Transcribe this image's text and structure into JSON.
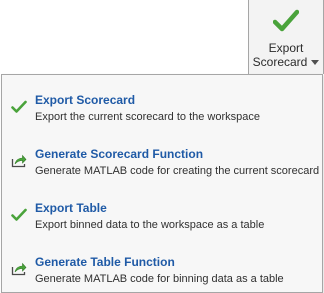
{
  "toolbar": {
    "export_button": {
      "label_line1": "Export",
      "label_line2": "Scorecard",
      "icon": "check-icon",
      "icon_color": "#4aa33b"
    }
  },
  "menu": {
    "items": [
      {
        "title": "Export Scorecard",
        "description": "Export the current scorecard to the workspace",
        "icon": "check-icon"
      },
      {
        "title": "Generate Scorecard Function",
        "description": "Generate MATLAB code for creating the current scorecard",
        "icon": "generate-code-icon"
      },
      {
        "title": "Export Table",
        "description": "Export binned data to the workspace as a table",
        "icon": "check-icon"
      },
      {
        "title": "Generate Table Function",
        "description": "Generate MATLAB code for binning data as a table",
        "icon": "generate-code-icon"
      }
    ]
  },
  "colors": {
    "title": "#1f5aa6",
    "check": "#4aa33b",
    "generate": "#3b8a2e"
  }
}
